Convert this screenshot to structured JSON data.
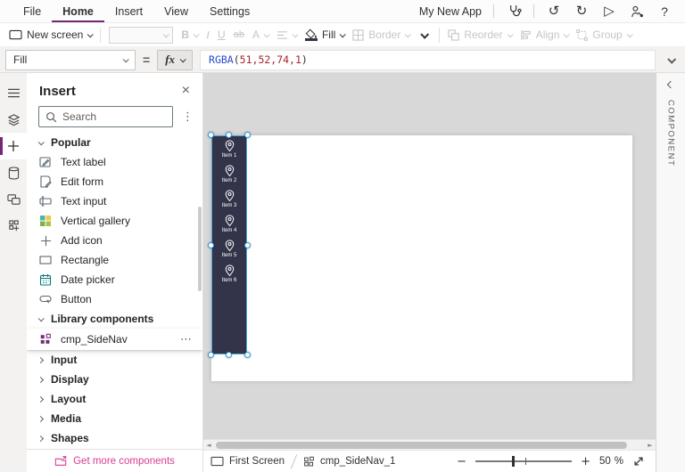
{
  "colors": {
    "accent_purple": "#742774",
    "component_fill_rgba": "RGBA(51,52,74,1)",
    "component_fill_hex": "#33344A",
    "selection_blue": "#45A8E0",
    "link_magenta": "#D83B94",
    "formula_function_color": "#2A49C9",
    "formula_number_color": "#A4262C"
  },
  "menu_bar": {
    "items": [
      {
        "label": "File"
      },
      {
        "label": "Home"
      },
      {
        "label": "Insert"
      },
      {
        "label": "View"
      },
      {
        "label": "Settings"
      }
    ],
    "app_name": "My New App",
    "undo_glyph": "↺",
    "redo_glyph": "↻",
    "play_glyph": "▷",
    "help_label": "?"
  },
  "toolbar": {
    "new_screen_label": "New screen",
    "bold_label": "B",
    "italic_label": "I",
    "underline_label": "U",
    "strikethrough_label": "ab",
    "font_color_label": "A",
    "fill_label": "Fill",
    "border_label": "Border",
    "reorder_label": "Reorder",
    "align_label": "Align",
    "group_label": "Group"
  },
  "formula_bar": {
    "property_selected": "Fill",
    "equals_sign": "=",
    "fx_label": "fx",
    "formula": {
      "function_name": "RGBA",
      "open_paren": "(",
      "arguments": "51,52,74,1",
      "close_paren": ")"
    }
  },
  "insert_panel": {
    "title": "Insert",
    "close_glyph": "×",
    "search_placeholder": "Search",
    "kebab_glyph": "⋮",
    "more_glyph": "⋯",
    "popular": {
      "header": "Popular",
      "items": [
        {
          "label": "Text label"
        },
        {
          "label": "Edit form"
        },
        {
          "label": "Text input"
        },
        {
          "label": "Vertical gallery"
        },
        {
          "label": "Add icon"
        },
        {
          "label": "Rectangle"
        },
        {
          "label": "Date picker"
        },
        {
          "label": "Button"
        }
      ]
    },
    "library": {
      "header": "Library components",
      "items": [
        {
          "label": "cmp_SideNav",
          "selected": true
        }
      ]
    },
    "collapsed_sections": [
      {
        "label": "Input"
      },
      {
        "label": "Display"
      },
      {
        "label": "Layout"
      },
      {
        "label": "Media"
      },
      {
        "label": "Shapes"
      }
    ],
    "footer_link": "Get more components"
  },
  "canvas": {
    "sidenav_component": {
      "name": "cmp_SideNav_1",
      "fill": "RGBA(51,52,74,1)",
      "items": [
        {
          "label": "Item 1"
        },
        {
          "label": "Item 2"
        },
        {
          "label": "Item 3"
        },
        {
          "label": "Item 4"
        },
        {
          "label": "Item 5"
        },
        {
          "label": "Item 6"
        }
      ]
    },
    "hscroll_left_glyph": "◄",
    "hscroll_right_glyph": "►"
  },
  "right_panel": {
    "collapsed_label": "COMPONENT"
  },
  "status_bar": {
    "breadcrumb": [
      {
        "label": "First Screen"
      },
      {
        "label": "cmp_SideNav_1"
      }
    ],
    "zoom": {
      "minus_glyph": "−",
      "plus_glyph": "+",
      "value": "50",
      "unit": "%"
    }
  }
}
